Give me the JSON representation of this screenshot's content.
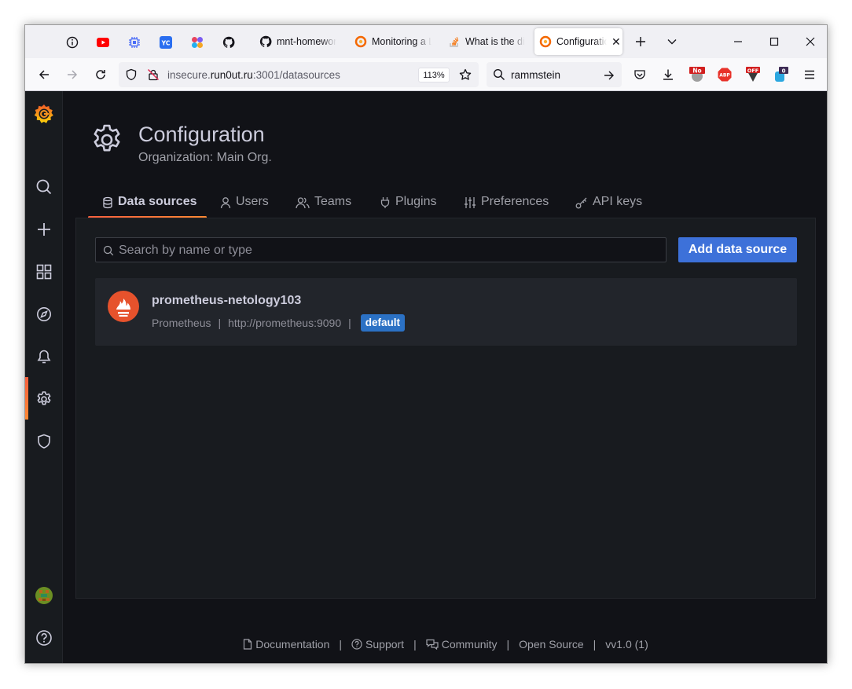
{
  "browser": {
    "tabs": [
      {
        "title": "mnt-homework",
        "favicon": "github-icon"
      },
      {
        "title": "Monitoring a Linux",
        "favicon": "grafana-icon"
      },
      {
        "title": "What is the difference",
        "favicon": "stackoverflow-icon"
      },
      {
        "title": "Configuration",
        "favicon": "grafana-icon",
        "active": true
      }
    ],
    "url_prefix": "insecure.",
    "url_domain": "run0ut.ru",
    "url_rest": ":3001/datasources",
    "zoom": "113%",
    "search_value": "rammstein",
    "ext_badges": {
      "no": "No",
      "abp": "ABP",
      "off": "OFF",
      "count": "0"
    }
  },
  "page": {
    "title": "Configuration",
    "subtitle": "Organization: Main Org."
  },
  "tabs": [
    {
      "label": "Data sources",
      "icon": "database-icon",
      "active": true
    },
    {
      "label": "Users",
      "icon": "user-icon"
    },
    {
      "label": "Teams",
      "icon": "users-icon"
    },
    {
      "label": "Plugins",
      "icon": "plug-icon"
    },
    {
      "label": "Preferences",
      "icon": "sliders-icon"
    },
    {
      "label": "API keys",
      "icon": "key-icon"
    }
  ],
  "search": {
    "placeholder": "Search by name or type"
  },
  "add_button": "Add data source",
  "datasource": {
    "name": "prometheus-netology103",
    "type": "Prometheus",
    "url": "http://prometheus:9090",
    "badge": "default"
  },
  "footer": {
    "documentation": "Documentation",
    "support": "Support",
    "community": "Community",
    "open_source": "Open Source",
    "version": "vv1.0 (1)",
    "separator": "|"
  },
  "colors": {
    "accent_orange": "#ff8833",
    "primary_blue": "#3d71d9",
    "badge_blue": "#2b71c4",
    "bg_canvas": "#111217",
    "bg_panel": "#181b1f"
  }
}
